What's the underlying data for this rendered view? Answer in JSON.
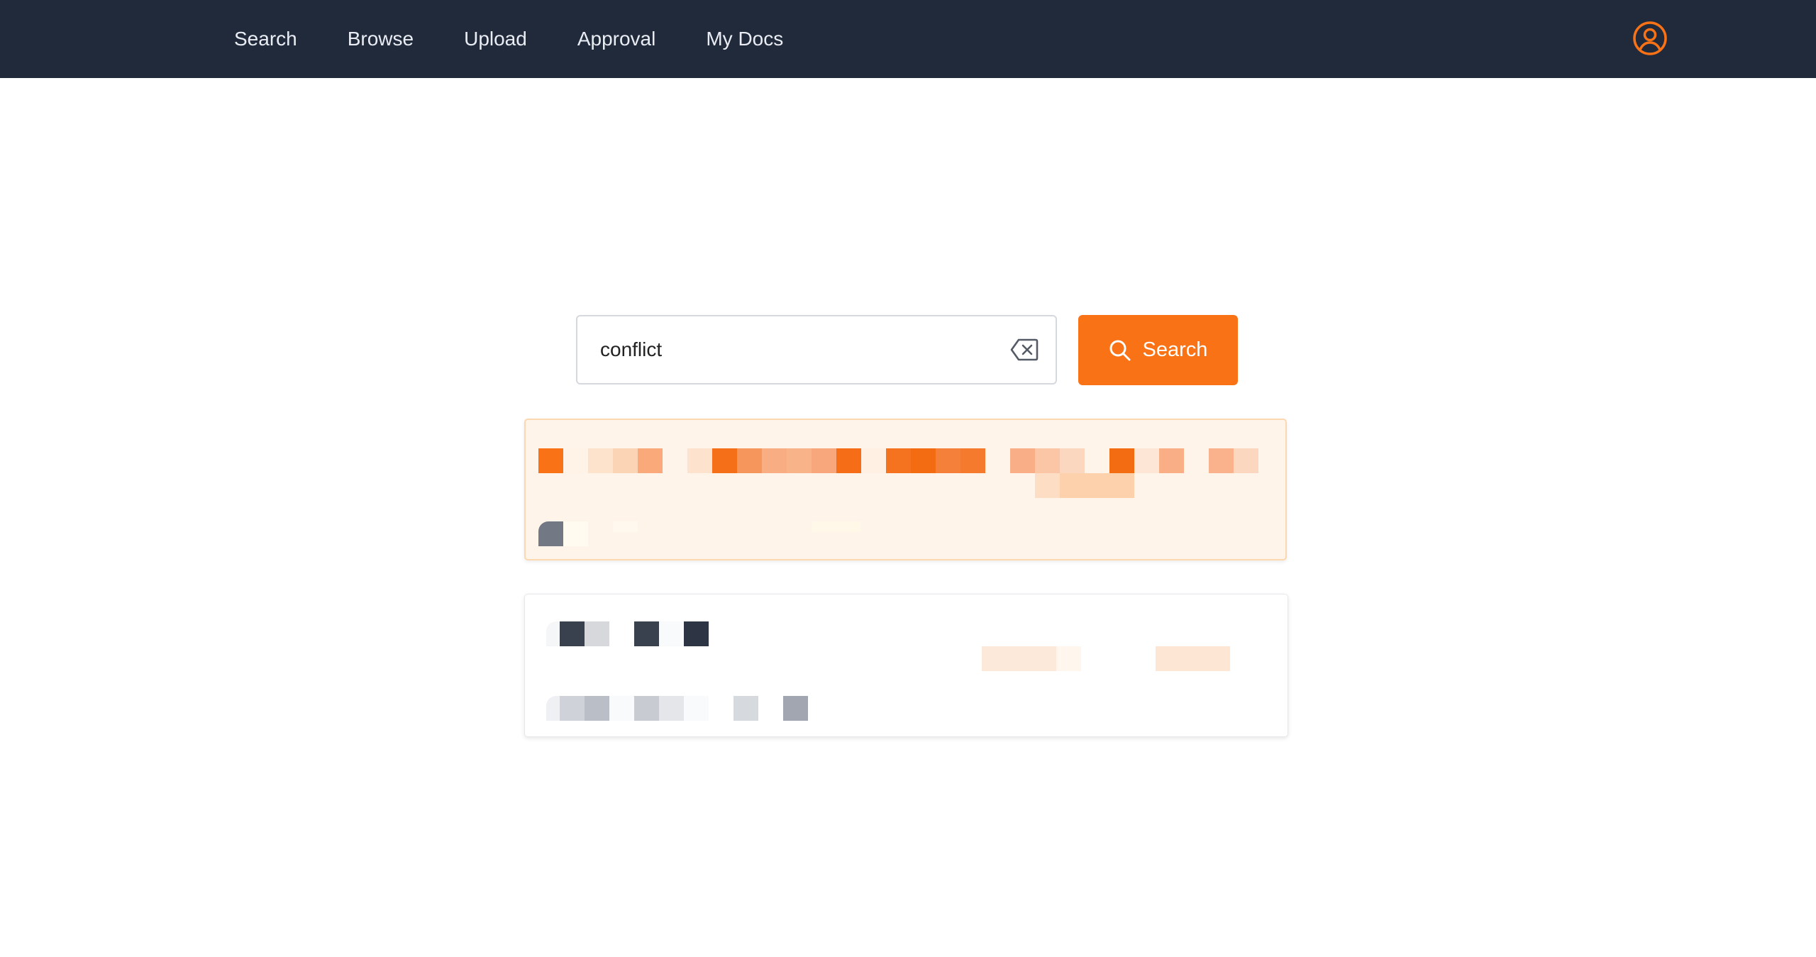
{
  "nav": {
    "items": [
      {
        "label": "Search"
      },
      {
        "label": "Browse"
      },
      {
        "label": "Upload"
      },
      {
        "label": "Approval"
      },
      {
        "label": "My Docs"
      }
    ],
    "account_icon": "user-circle-icon"
  },
  "search": {
    "value": "conflict",
    "clear_icon": "backspace-clear-icon",
    "button_label": "Search",
    "button_icon": "search-icon"
  },
  "colors": {
    "topbar": "#212a3b",
    "accent": "#f97316",
    "highlight_bg": "#fff4e9",
    "highlight_border": "#fcd8b0"
  },
  "results": [
    {
      "state": "highlighted",
      "content": "pixelated-redacted"
    },
    {
      "state": "normal",
      "content": "pixelated-redacted"
    }
  ]
}
